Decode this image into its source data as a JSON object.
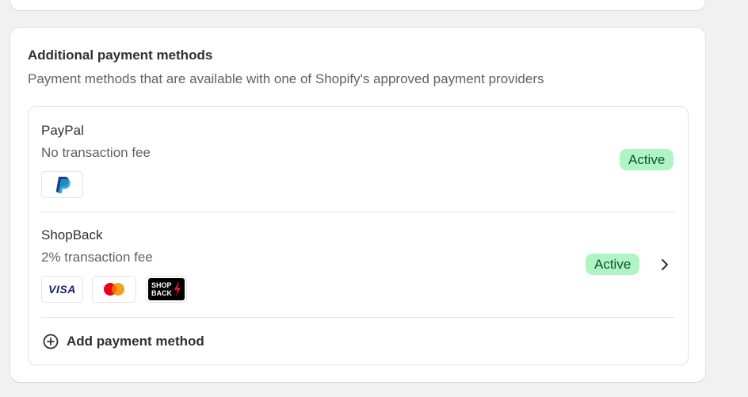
{
  "section": {
    "title": "Additional payment methods",
    "subtitle": "Payment methods that are available with one of Shopify's approved payment providers"
  },
  "methods": [
    {
      "name": "PayPal",
      "fee": "No transaction fee",
      "status": "Active",
      "logos": [
        "paypal-logo"
      ]
    },
    {
      "name": "ShopBack",
      "fee": "2% transaction fee",
      "status": "Active",
      "logos": [
        "visa-logo",
        "mastercard-logo",
        "shopback-logo"
      ],
      "logo_text": {
        "visa": "VISA",
        "shopback_line1": "SHOP",
        "shopback_line2": "BACK"
      }
    }
  ],
  "add_action": {
    "label": "Add payment method",
    "icon": "plus-circle-icon"
  },
  "colors": {
    "badge_bg": "#aff5c3",
    "badge_text": "#0c5132",
    "paypal_dark": "#253b80",
    "paypal_light": "#179bd7",
    "visa_blue": "#1a1f71",
    "mc_red": "#eb001b",
    "mc_orange": "#f79e1b"
  }
}
